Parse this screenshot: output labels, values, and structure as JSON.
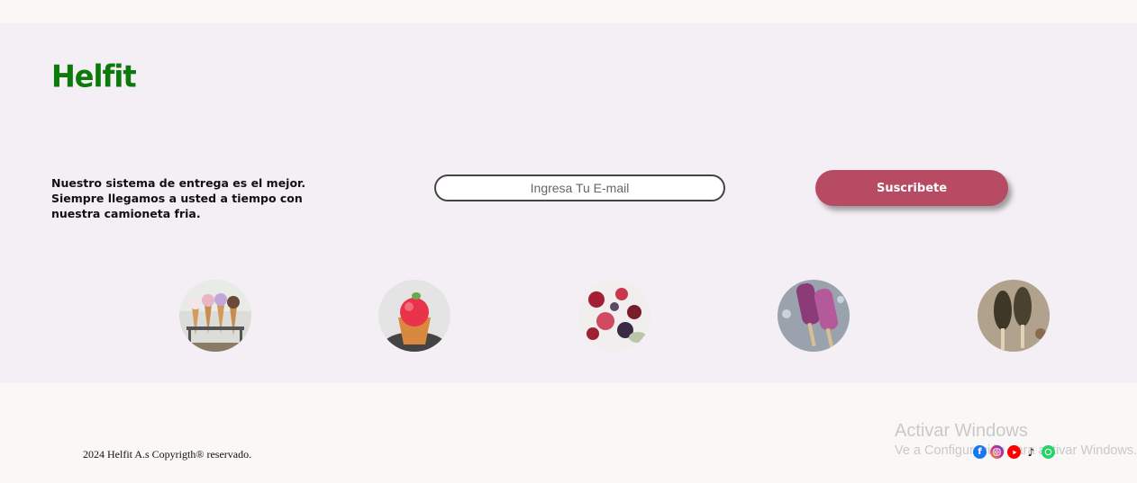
{
  "brand": {
    "logo": "Helfit"
  },
  "newsletter": {
    "pitch": "Nuestro sistema de entrega es el mejor. Siempre llegamos a usted a tiempo con nuestra camioneta fria.",
    "email_placeholder": "Ingresa Tu E-mail",
    "email_value": "",
    "subscribe_label": "Suscribete"
  },
  "gallery": [
    {
      "icon": "ice-cream-cones-image"
    },
    {
      "icon": "sorbet-cup-image"
    },
    {
      "icon": "berry-dessert-image"
    },
    {
      "icon": "berry-popsicles-image"
    },
    {
      "icon": "chocolate-popsicles-image"
    }
  ],
  "footer": {
    "copyright": "2024 Helfit A.s Copyrigth® reservado.",
    "socials": [
      {
        "icon": "facebook-icon",
        "color": "#1877f2"
      },
      {
        "icon": "instagram-icon",
        "color": "#c13584"
      },
      {
        "icon": "youtube-icon",
        "color": "#ff0000"
      },
      {
        "icon": "tiktok-icon",
        "color": "#111111"
      },
      {
        "icon": "whatsapp-icon",
        "color": "#25d366"
      }
    ]
  },
  "watermark": {
    "title": "Activar Windows",
    "subtitle": "Ve a Configuración para activar Windows."
  },
  "colors": {
    "brand_green": "#0b7a0b",
    "button": "#b64b63",
    "band": "#f4eff4"
  }
}
